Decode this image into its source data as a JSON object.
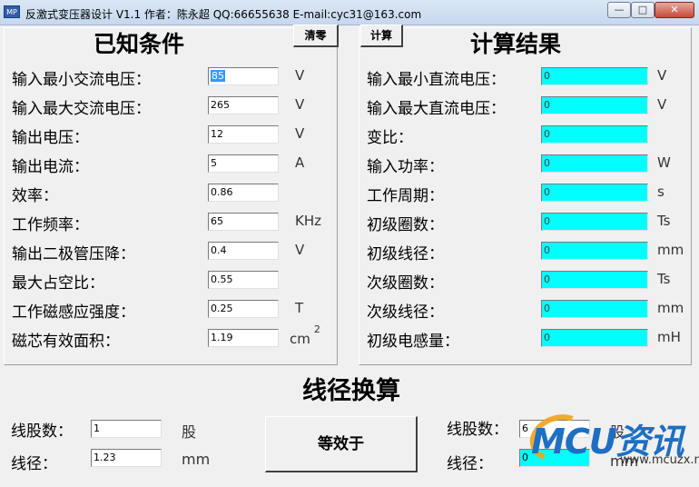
{
  "window": {
    "title": "反激式变压器设计   V1.1   作者：陈永超   QQ:66655638   E-mail:cyc31@163.com",
    "icon_text": "MP",
    "minimize": "—",
    "maximize": "□",
    "close": "✕"
  },
  "known": {
    "title": "已知条件",
    "clear_button": "清零",
    "rows": [
      {
        "label": "输入最小交流电压：",
        "value": "85",
        "unit": "V"
      },
      {
        "label": "输入最大交流电压：",
        "value": "265",
        "unit": "V"
      },
      {
        "label": "输出电压：",
        "value": "12",
        "unit": "V"
      },
      {
        "label": "输出电流：",
        "value": "5",
        "unit": "A"
      },
      {
        "label": "效率：",
        "value": "0.86",
        "unit": ""
      },
      {
        "label": "工作频率：",
        "value": "65",
        "unit": "KHz"
      },
      {
        "label": "输出二极管压降：",
        "value": "0.4",
        "unit": "V"
      },
      {
        "label": "最大占空比：",
        "value": "0.55",
        "unit": ""
      },
      {
        "label": "工作磁感应强度：",
        "value": "0.25",
        "unit": "T"
      },
      {
        "label": "磁芯有效面积：",
        "value": "1.19",
        "unit": "cm",
        "unit_sup": "2"
      }
    ]
  },
  "results": {
    "title": "计算结果",
    "calc_button": "计算",
    "rows": [
      {
        "label": "输入最小直流电压：",
        "value": "0",
        "unit": "V"
      },
      {
        "label": "输入最大直流电压：",
        "value": "0",
        "unit": "V"
      },
      {
        "label": "变比：",
        "value": "0",
        "unit": ""
      },
      {
        "label": "输入功率：",
        "value": "0",
        "unit": "W"
      },
      {
        "label": "工作周期：",
        "value": "0",
        "unit": "s"
      },
      {
        "label": "初级圈数：",
        "value": "0",
        "unit": "Ts"
      },
      {
        "label": "初级线径：",
        "value": "0",
        "unit": "mm"
      },
      {
        "label": "次级圈数：",
        "value": "0",
        "unit": "Ts"
      },
      {
        "label": "次级线径：",
        "value": "0",
        "unit": "mm"
      },
      {
        "label": "初级电感量：",
        "value": "0",
        "unit": "mH"
      }
    ]
  },
  "conversion": {
    "title": "线径换算",
    "left": {
      "strands_label": "线股数：",
      "strands_value": "1",
      "strands_unit": "股",
      "diameter_label": "线径：",
      "diameter_value": "1.23",
      "diameter_unit": "mm"
    },
    "equiv_button": "等效于",
    "right": {
      "strands_label": "线股数：",
      "strands_value": "6",
      "strands_unit": "股",
      "diameter_label": "线径：",
      "diameter_value": "0",
      "diameter_unit": "mm"
    }
  },
  "watermark": {
    "logo": "MCU资讯",
    "url": "www.mcuzx.net"
  },
  "colors": {
    "result_field": "#00ffff",
    "selection": "#3399ff",
    "window_bg": "#f0f0f0"
  }
}
